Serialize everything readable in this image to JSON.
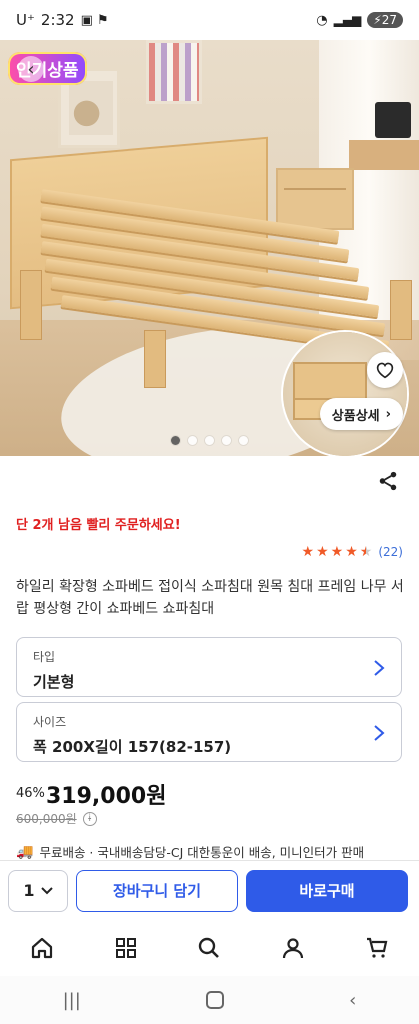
{
  "status_bar": {
    "carrier": "U⁺",
    "time": "2:32",
    "battery": "27"
  },
  "hero": {
    "badge_text": "인기상품",
    "detail_button_label": "상품상세",
    "slide_count": 5,
    "active_slide": 1
  },
  "product": {
    "urgency": "단 2개 남음 빨리 주문하세요!",
    "rating_stars": 4.5,
    "review_count": "(22)",
    "title": "하일리 확장형 소파베드 접이식 소파침대 원목 침대 프레임 나무 서랍 평상형 간이 쇼파베드 쇼파침대"
  },
  "options": [
    {
      "label": "타입",
      "value": "기본형"
    },
    {
      "label": "사이즈",
      "value": "폭 200X길이 157(82-157)"
    }
  ],
  "pricing": {
    "discount": "46%",
    "price": "319,000원",
    "original_price": "600,000원",
    "info_symbol": "i"
  },
  "shipping": {
    "text": "무료배송 · 국내배송담당-CJ 대한통운이 배송, 미니인터가 판매"
  },
  "purchase_bar": {
    "quantity": "1",
    "cart_label": "장바구니 담기",
    "buy_label": "바로구매"
  },
  "colors": {
    "accent": "#2f5be8",
    "urgent": "#e02020",
    "star": "#f05a28",
    "review_link": "#3d6fd8"
  },
  "icons": {
    "bottom_nav": [
      "home-icon",
      "category-grid-icon",
      "search-icon",
      "user-icon",
      "cart-icon"
    ],
    "system_nav": [
      "recent-apps-icon",
      "home-circle-icon",
      "back-icon"
    ]
  }
}
